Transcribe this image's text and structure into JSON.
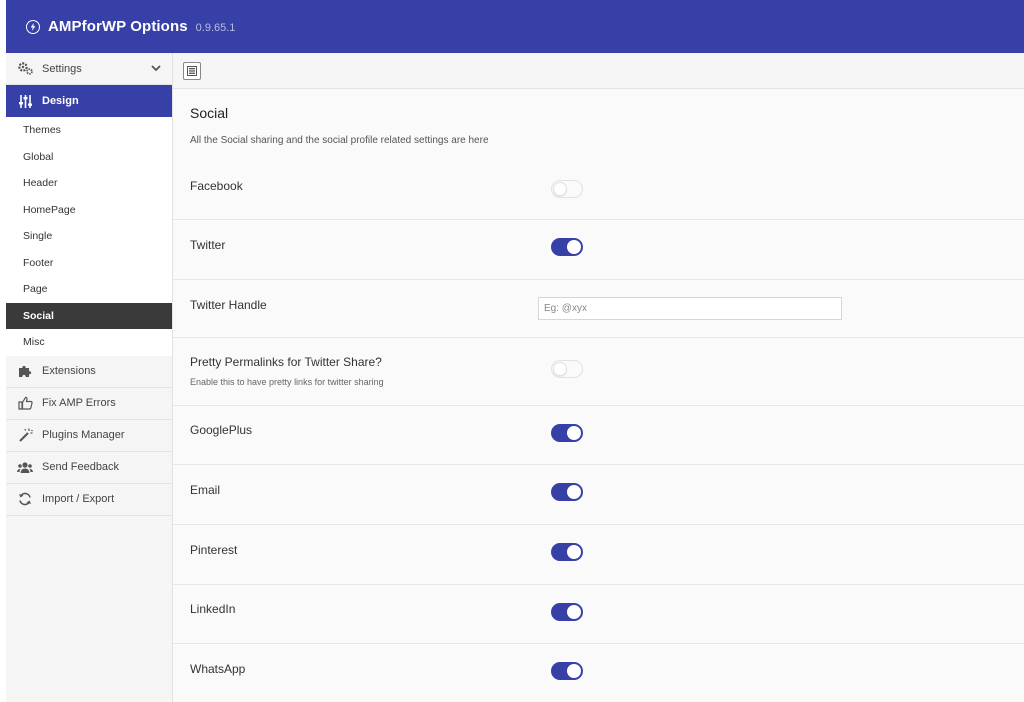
{
  "header": {
    "title": "AMPforWP Options",
    "version": "0.9.65.1"
  },
  "sidebar": {
    "settings": "Settings",
    "design": "Design",
    "design_sub": [
      "Themes",
      "Global",
      "Header",
      "HomePage",
      "Single",
      "Footer",
      "Page",
      "Social",
      "Misc"
    ],
    "active_sub": "Social",
    "extensions": "Extensions",
    "fix_amp_errors": "Fix AMP Errors",
    "plugins_manager": "Plugins Manager",
    "send_feedback": "Send Feedback",
    "import_export": "Import / Export"
  },
  "section": {
    "title": "Social",
    "description": "All the Social sharing and the social profile related settings are here"
  },
  "fields": {
    "facebook": {
      "label": "Facebook",
      "enabled": false
    },
    "twitter": {
      "label": "Twitter",
      "enabled": true
    },
    "twitter_handle": {
      "label": "Twitter Handle",
      "placeholder": "Eg: @xyx",
      "value": ""
    },
    "pretty_permalinks": {
      "label": "Pretty Permalinks for Twitter Share?",
      "sublabel": "Enable this to have pretty links for twitter sharing",
      "enabled": false
    },
    "googleplus": {
      "label": "GooglePlus",
      "enabled": true
    },
    "email": {
      "label": "Email",
      "enabled": true
    },
    "pinterest": {
      "label": "Pinterest",
      "enabled": true
    },
    "linkedin": {
      "label": "LinkedIn",
      "enabled": true
    },
    "whatsapp": {
      "label": "WhatsApp",
      "enabled": true
    }
  },
  "colors": {
    "accent": "#3740a6",
    "active_submenu": "#3a3a3a",
    "sidebar_bg": "#f5f5f5"
  },
  "icons": {
    "header": "lightning-circle-icon",
    "settings": "gears-icon",
    "design": "sliders-icon",
    "extensions": "puzzle-icon",
    "fix_amp_errors": "thumbs-up-icon",
    "plugins_manager": "magic-wand-icon",
    "send_feedback": "users-icon",
    "import_export": "refresh-icon",
    "toolbar": "expand-icon"
  }
}
